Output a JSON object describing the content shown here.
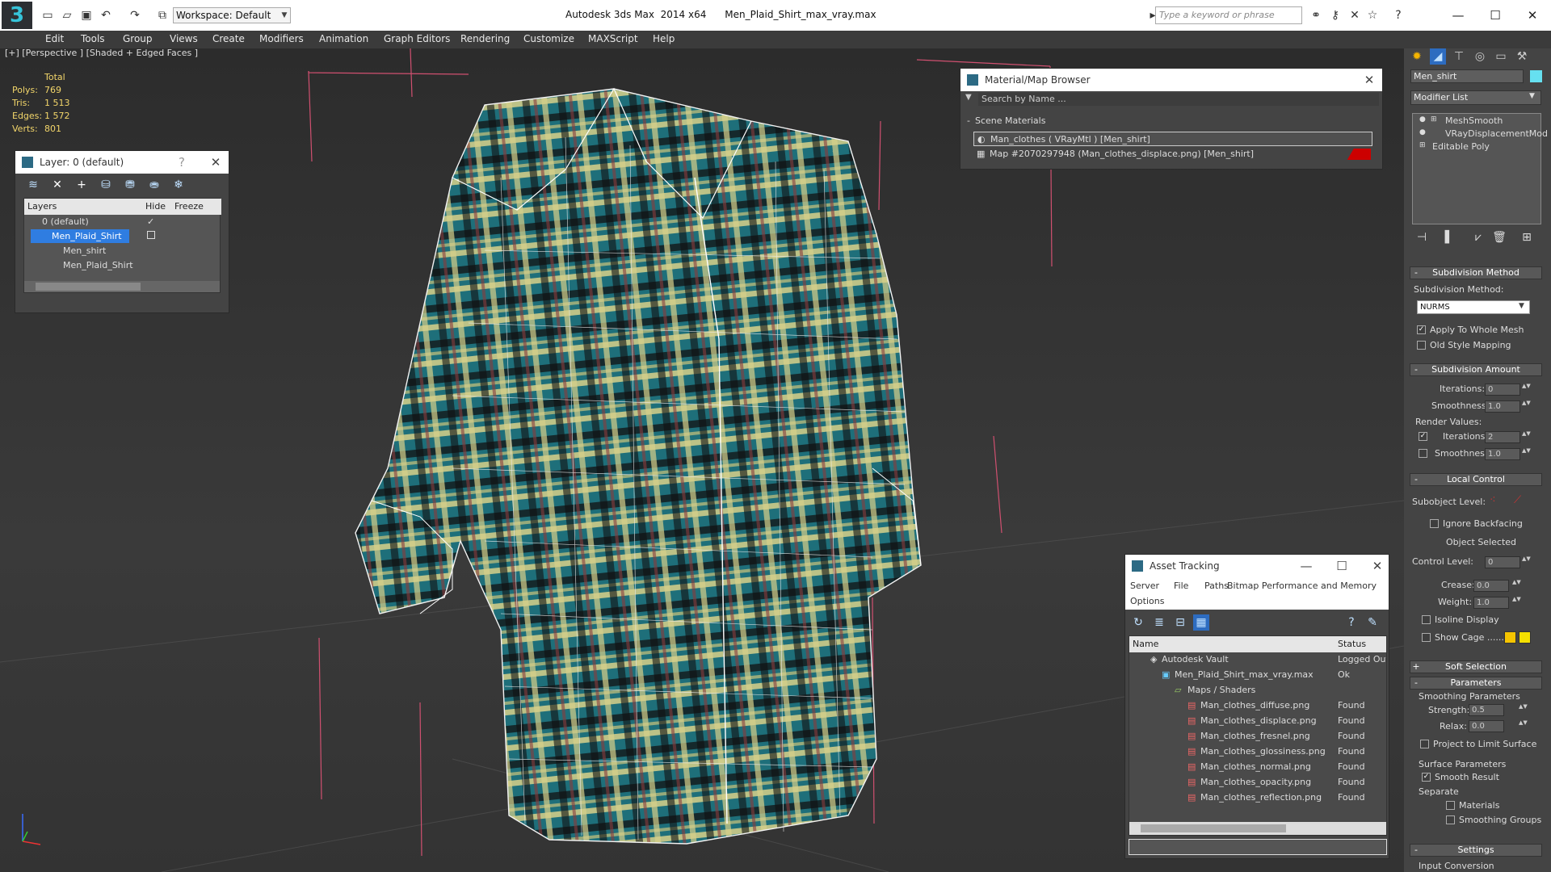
{
  "app": {
    "title": "Autodesk 3ds Max  2014 x64      Men_Plaid_Shirt_max_vray.max",
    "workspace": "Workspace: Default",
    "search_placeholder": "Type a keyword or phrase",
    "logo": "3",
    "minimize": "—",
    "maximize": "☐",
    "close": "✕"
  },
  "menu": [
    "Edit",
    "Tools",
    "Group",
    "Views",
    "Create",
    "Modifiers",
    "Animation",
    "Graph Editors",
    "Rendering",
    "Customize",
    "MAXScript",
    "Help"
  ],
  "viewport": {
    "label": "[+] [Perspective ] [Shaded + Edged Faces ]",
    "stats": {
      "header": "Total",
      "rows": [
        {
          "k": "Polys:",
          "v": "769"
        },
        {
          "k": "Tris:",
          "v": "1 513"
        },
        {
          "k": "Edges:",
          "v": "1 572"
        },
        {
          "k": "Verts:",
          "v": "801"
        }
      ]
    }
  },
  "layer_panel": {
    "title": "Layer: 0 (default)",
    "help": "?",
    "close": "✕",
    "columns": [
      "Layers",
      "Hide",
      "Freeze"
    ],
    "rows": [
      "0 (default)",
      "Men_Plaid_Shirt",
      "Men_shirt",
      "Men_Plaid_Shirt"
    ],
    "check": "✓"
  },
  "material_browser": {
    "title": "Material/Map Browser",
    "close": "✕",
    "search": "Search by Name ...",
    "section": "Scene Materials",
    "section_toggle": "-",
    "items": [
      "Man_clothes  ( VRayMtl ) [Men_shirt]",
      "Map #2070297948 (Man_clothes_displace.png) [Men_shirt]"
    ]
  },
  "asset_tracking": {
    "title": "Asset Tracking",
    "min": "—",
    "max": "☐",
    "close": "✕",
    "menu": [
      "Server",
      "File",
      "Paths",
      "Bitmap Performance and Memory",
      "Options"
    ],
    "columns": [
      "Name",
      "Status"
    ],
    "rows": [
      {
        "name": "Autodesk Vault",
        "status": "Logged Out"
      },
      {
        "name": "Men_Plaid_Shirt_max_vray.max",
        "status": "Ok"
      },
      {
        "name": "Maps / Shaders",
        "status": ""
      },
      {
        "name": "Man_clothes_diffuse.png",
        "status": "Found"
      },
      {
        "name": "Man_clothes_displace.png",
        "status": "Found"
      },
      {
        "name": "Man_clothes_fresnel.png",
        "status": "Found"
      },
      {
        "name": "Man_clothes_glossiness.png",
        "status": "Found"
      },
      {
        "name": "Man_clothes_normal.png",
        "status": "Found"
      },
      {
        "name": "Man_clothes_opacity.png",
        "status": "Found"
      },
      {
        "name": "Man_clothes_reflection.png",
        "status": "Found"
      }
    ]
  },
  "command_panel": {
    "object_name": "Men_shirt",
    "modifier_list": "Modifier List",
    "stack": [
      "MeshSmooth",
      "VRayDisplacementMod",
      "Editable Poly"
    ],
    "subdivision_method": {
      "title": "Subdivision Method",
      "label": "Subdivision Method:",
      "value": "NURMS",
      "apply": "Apply To Whole Mesh",
      "old_style": "Old Style Mapping"
    },
    "subdivision_amount": {
      "title": "Subdivision Amount",
      "iterations_label": "Iterations:",
      "iterations": "0",
      "smoothness_label": "Smoothness:",
      "smoothness": "1.0",
      "render_values": "Render Values:",
      "r_iterations": "2",
      "r_smoothness": "1.0"
    },
    "local_control": {
      "title": "Local Control",
      "subobject": "Subobject Level:",
      "ignore_backfacing": "Ignore Backfacing",
      "object_selected": "Object Selected",
      "control_level_label": "Control Level:",
      "control_level": "0",
      "crease_label": "Crease:",
      "crease": "0.0",
      "weight_label": "Weight:",
      "weight": "1.0",
      "isoline": "Isoline Display",
      "show_cage": "Show Cage ......"
    },
    "soft_selection": {
      "title": "Soft Selection",
      "toggle": "+"
    },
    "parameters": {
      "title": "Parameters",
      "smoothing_params": "Smoothing Parameters",
      "strength_label": "Strength:",
      "strength": "0.5",
      "relax_label": "Relax:",
      "relax": "0.0",
      "project": "Project to Limit Surface",
      "surface_params": "Surface Parameters",
      "smooth_result": "Smooth Result",
      "separate": "Separate",
      "materials": "Materials",
      "smoothing_groups": "Smoothing Groups"
    },
    "settings": {
      "title": "Settings",
      "input_conversion": "Input Conversion"
    },
    "collapse": "-"
  },
  "colors": {
    "accent": "#3b82f6",
    "cage1": "#f5c400",
    "cage2": "#f5e000"
  }
}
